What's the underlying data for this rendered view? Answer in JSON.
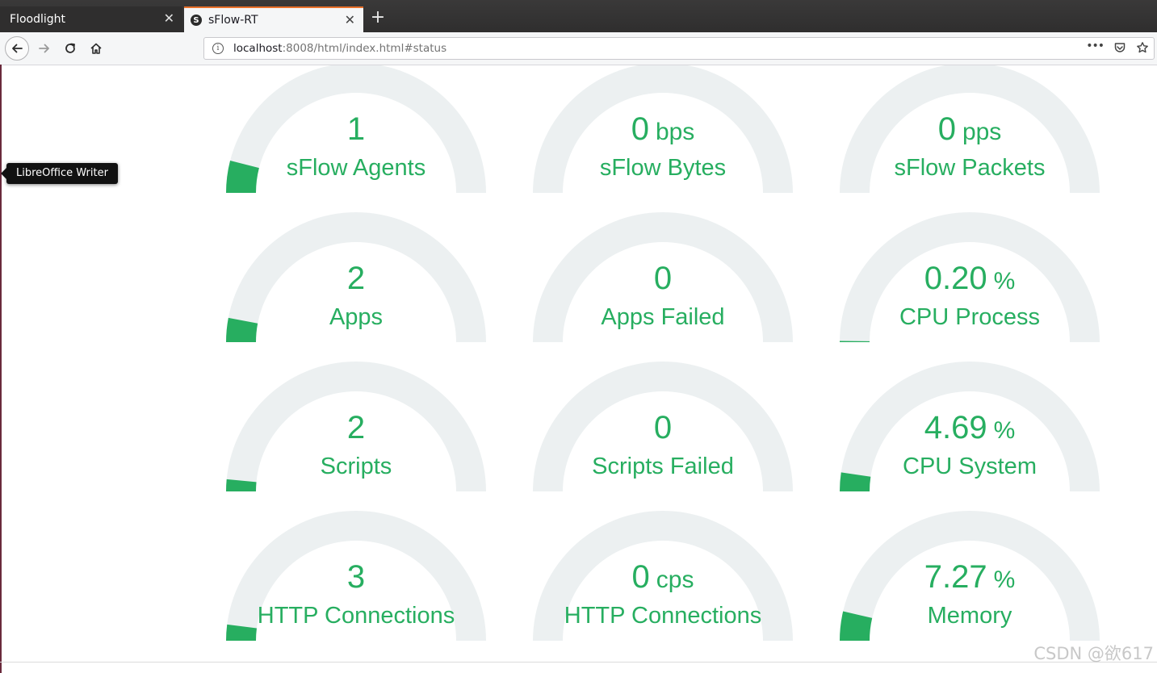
{
  "browser": {
    "tabs": [
      {
        "title": "Floodlight",
        "close": "✕"
      },
      {
        "title": "sFlow-RT",
        "close": "✕",
        "favicon": "S"
      }
    ],
    "new_tab": "+",
    "url_host": "localhost",
    "url_rest": ":8008/html/index.html#status",
    "info_icon": "i",
    "menu_icon": "•••"
  },
  "tooltip": "LibreOffice Writer",
  "colors": {
    "accent": "#27ae60",
    "track": "#ecf0f1"
  },
  "gauges": [
    {
      "value": "1",
      "unit": "",
      "label": "sFlow Agents",
      "fill": 0.08
    },
    {
      "value": "0",
      "unit": "bps",
      "label": "sFlow Bytes",
      "fill": 0
    },
    {
      "value": "0",
      "unit": "pps",
      "label": "sFlow Packets",
      "fill": 0
    },
    {
      "value": "2",
      "unit": "",
      "label": "Apps",
      "fill": 0.06
    },
    {
      "value": "0",
      "unit": "",
      "label": "Apps Failed",
      "fill": 0
    },
    {
      "value": "0.20",
      "unit": "%",
      "label": "CPU Process",
      "fill": 0.003
    },
    {
      "value": "2",
      "unit": "",
      "label": "Scripts",
      "fill": 0.03
    },
    {
      "value": "0",
      "unit": "",
      "label": "Scripts Failed",
      "fill": 0
    },
    {
      "value": "4.69",
      "unit": "%",
      "label": "CPU System",
      "fill": 0.047
    },
    {
      "value": "3",
      "unit": "",
      "label": "HTTP Connections",
      "fill": 0.04
    },
    {
      "value": "0",
      "unit": "cps",
      "label": "HTTP Connections",
      "fill": 0
    },
    {
      "value": "7.27",
      "unit": "%",
      "label": "Memory",
      "fill": 0.0727
    }
  ],
  "watermark": "CSDN @欲617"
}
